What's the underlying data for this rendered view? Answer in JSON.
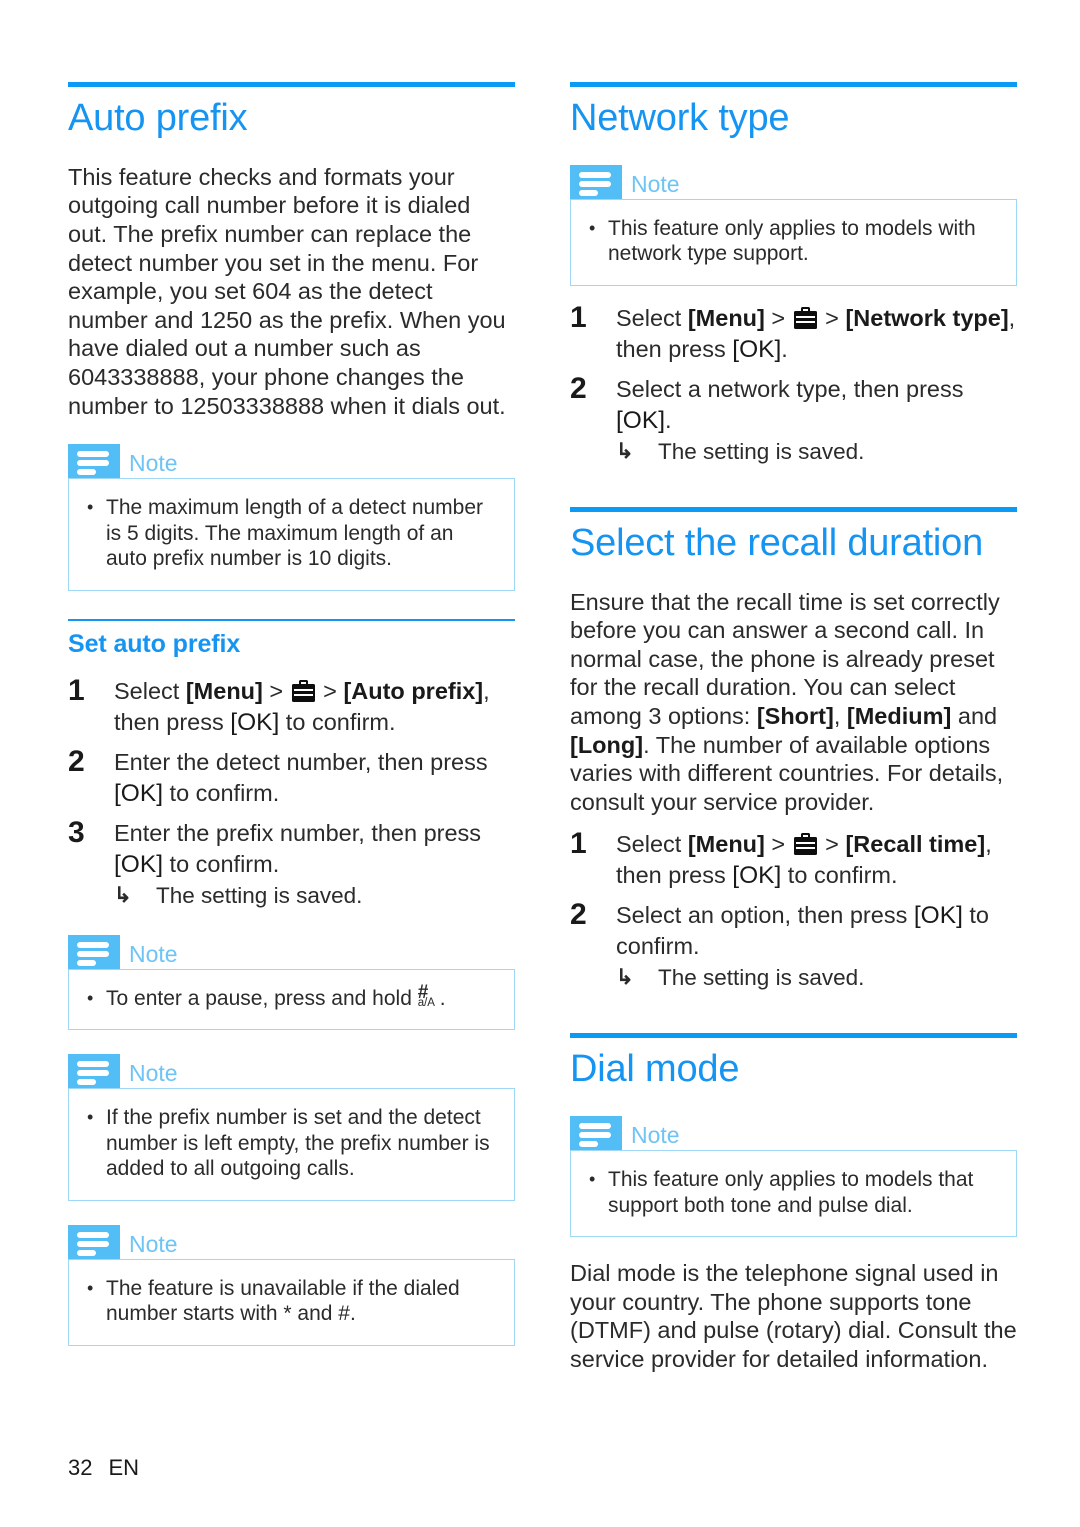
{
  "page": {
    "number": "32",
    "language": "EN"
  },
  "colors": {
    "heading_blue": "#1694f2",
    "rule_blue": "#0b9bf5",
    "note_icon_blue": "#53bdf5",
    "note_title_blue": "#6ec4f5",
    "note_border_blue": "#9fd8f7",
    "body_text": "#2b2b2b"
  },
  "left_column": {
    "section": {
      "title": "Auto prefix",
      "intro": "This feature checks and formats your outgoing call number before it is dialed out. The prefix number can replace the detect number you set in the menu. For example, you set 604 as the detect number and 1250 as the prefix. When you have dialed out a number such as 6043338888, your phone changes the number to 12503338888 when it dials out."
    },
    "note_1": {
      "label": "Note",
      "items": [
        "The maximum length of a detect number is 5 digits. The maximum length of an auto prefix number is 10 digits."
      ]
    },
    "subsection": {
      "title": "Set auto prefix",
      "steps": [
        {
          "num": "1",
          "parts": [
            {
              "t": "text",
              "v": "Select "
            },
            {
              "t": "ui",
              "v": "[Menu]"
            },
            {
              "t": "text",
              "v": " > "
            },
            {
              "t": "icon",
              "v": "briefcase-icon"
            },
            {
              "t": "text",
              "v": " > "
            },
            {
              "t": "ui",
              "v": "[Auto prefix]"
            },
            {
              "t": "text",
              "v": ", then press "
            },
            {
              "t": "ok",
              "v": "[OK]"
            },
            {
              "t": "text",
              "v": " to confirm."
            }
          ]
        },
        {
          "num": "2",
          "parts": [
            {
              "t": "text",
              "v": "Enter the detect number, then press "
            },
            {
              "t": "ok",
              "v": "[OK]"
            },
            {
              "t": "text",
              "v": " to confirm."
            }
          ]
        },
        {
          "num": "3",
          "parts": [
            {
              "t": "text",
              "v": "Enter the prefix number, then press "
            },
            {
              "t": "ok",
              "v": "[OK]"
            },
            {
              "t": "text",
              "v": " to confirm."
            }
          ],
          "substep": {
            "arrow": "↳",
            "text": "The setting is saved."
          }
        }
      ]
    },
    "note_2": {
      "label": "Note",
      "item_prefix": "To enter a pause, press and hold ",
      "key_hash": "#",
      "key_sub": "a/A",
      "item_suffix": "."
    },
    "note_3": {
      "label": "Note",
      "items": [
        "If the prefix number is set and the detect number is left empty, the prefix number is added to all outgoing calls."
      ]
    },
    "note_4": {
      "label": "Note",
      "items": [
        "The feature is unavailable if the dialed number starts with * and #."
      ]
    }
  },
  "right_column": {
    "network_type": {
      "title": "Network type",
      "note": {
        "label": "Note",
        "items": [
          "This feature only applies to models with network type support."
        ]
      },
      "steps": [
        {
          "num": "1",
          "parts": [
            {
              "t": "text",
              "v": "Select "
            },
            {
              "t": "ui",
              "v": "[Menu]"
            },
            {
              "t": "text",
              "v": " > "
            },
            {
              "t": "icon",
              "v": "briefcase-icon"
            },
            {
              "t": "text",
              "v": " > "
            },
            {
              "t": "ui",
              "v": "[Network type]"
            },
            {
              "t": "text",
              "v": ", then press "
            },
            {
              "t": "ok",
              "v": "[OK]"
            },
            {
              "t": "text",
              "v": "."
            }
          ]
        },
        {
          "num": "2",
          "parts": [
            {
              "t": "text",
              "v": "Select a network type, then press "
            },
            {
              "t": "ok",
              "v": "[OK]"
            },
            {
              "t": "text",
              "v": "."
            }
          ],
          "substep": {
            "arrow": "↳",
            "text": "The setting is saved."
          }
        }
      ]
    },
    "recall_duration": {
      "title": "Select the recall duration",
      "intro_parts": [
        {
          "t": "text",
          "v": "Ensure that the recall time is set correctly before you can answer a second call. In normal case, the phone is already preset for the recall duration. You can select among 3 options: "
        },
        {
          "t": "ui",
          "v": "[Short]"
        },
        {
          "t": "text",
          "v": ", "
        },
        {
          "t": "ui",
          "v": "[Medium]"
        },
        {
          "t": "text",
          "v": " and "
        },
        {
          "t": "ui",
          "v": "[Long]"
        },
        {
          "t": "text",
          "v": ". The number of available options varies with different countries. For details, consult your service provider."
        }
      ],
      "steps": [
        {
          "num": "1",
          "parts": [
            {
              "t": "text",
              "v": "Select "
            },
            {
              "t": "ui",
              "v": "[Menu]"
            },
            {
              "t": "text",
              "v": " > "
            },
            {
              "t": "icon",
              "v": "briefcase-icon"
            },
            {
              "t": "text",
              "v": " > "
            },
            {
              "t": "ui",
              "v": "[Recall time]"
            },
            {
              "t": "text",
              "v": ", then press "
            },
            {
              "t": "ok",
              "v": "[OK]"
            },
            {
              "t": "text",
              "v": " to confirm."
            }
          ]
        },
        {
          "num": "2",
          "parts": [
            {
              "t": "text",
              "v": "Select an option, then press "
            },
            {
              "t": "ok",
              "v": "[OK]"
            },
            {
              "t": "text",
              "v": " to confirm."
            }
          ],
          "substep": {
            "arrow": "↳",
            "text": "The setting is saved."
          }
        }
      ]
    },
    "dial_mode": {
      "title": "Dial mode",
      "note": {
        "label": "Note",
        "items": [
          "This feature only applies to models that support both tone and pulse dial."
        ]
      },
      "body": "Dial mode is the telephone signal used in your country. The phone supports tone (DTMF) and pulse (rotary) dial. Consult the service provider for detailed information."
    }
  }
}
